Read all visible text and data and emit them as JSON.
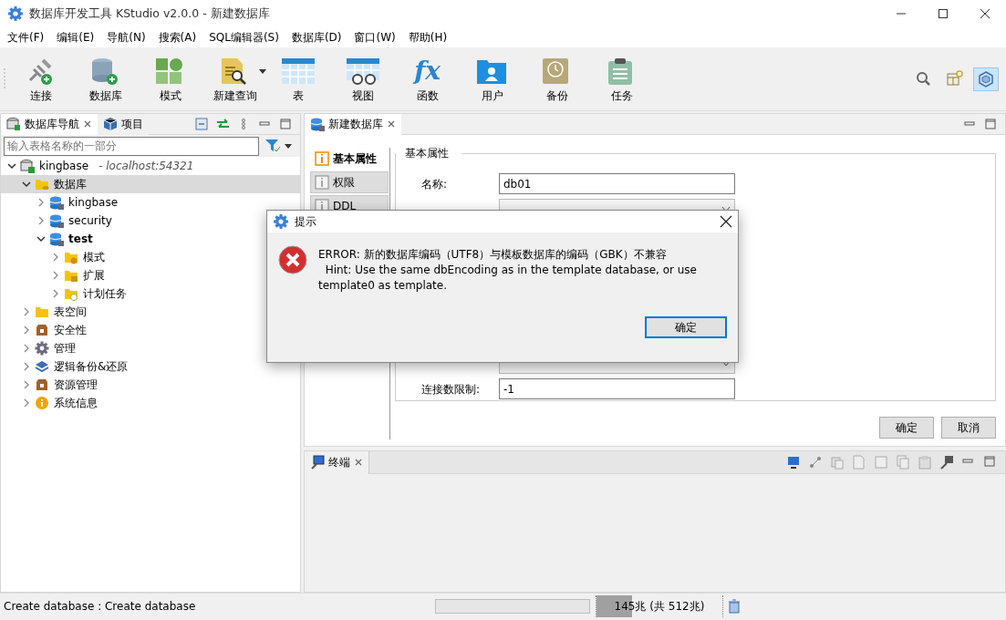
{
  "window": {
    "title": "数据库开发工具 KStudio v2.0.0 - 新建数据库"
  },
  "menu": [
    "文件(F)",
    "编辑(E)",
    "导航(N)",
    "搜索(A)",
    "SQL编辑器(S)",
    "数据库(D)",
    "窗口(W)",
    "帮助(H)"
  ],
  "toolbar": [
    {
      "label": "连接",
      "kind": "connect"
    },
    {
      "label": "数据库",
      "kind": "database"
    },
    {
      "label": "模式",
      "kind": "schema"
    },
    {
      "label": "新建查询",
      "kind": "query",
      "dropdown": true
    },
    {
      "label": "表",
      "kind": "table"
    },
    {
      "label": "视图",
      "kind": "view"
    },
    {
      "label": "函数",
      "kind": "function",
      "glyph": "fx"
    },
    {
      "label": "用户",
      "kind": "user"
    },
    {
      "label": "备份",
      "kind": "backup"
    },
    {
      "label": "任务",
      "kind": "task"
    }
  ],
  "toolbar_right": [
    {
      "kind": "search",
      "selected": false
    },
    {
      "kind": "table-add",
      "selected": false
    },
    {
      "kind": "cube",
      "selected": true
    }
  ],
  "navigator": {
    "tabs": [
      {
        "label": "数据库导航",
        "selected": true,
        "closable": true
      },
      {
        "label": "项目",
        "selected": false,
        "closable": false
      }
    ],
    "filter": {
      "placeholder": "输入表格名称的一部分"
    },
    "tree": [
      {
        "label": "kingbase",
        "host": "- localhost:54321",
        "kind": "connection",
        "expanded": true,
        "selected": false,
        "bold": false,
        "children": [
          {
            "label": "数据库",
            "kind": "folder-db",
            "expanded": true,
            "selected": true,
            "bold": false,
            "children": [
              {
                "label": "kingbase",
                "kind": "database",
                "expanded": false,
                "selected": false,
                "bold": false
              },
              {
                "label": "security",
                "kind": "database",
                "expanded": false,
                "selected": false,
                "bold": false
              },
              {
                "label": "test",
                "kind": "database",
                "expanded": true,
                "selected": false,
                "bold": true,
                "children": [
                  {
                    "label": "模式",
                    "kind": "folder-schema",
                    "expanded": false,
                    "selected": false,
                    "bold": false
                  },
                  {
                    "label": "扩展",
                    "kind": "folder-ext",
                    "expanded": false,
                    "selected": false,
                    "bold": false
                  },
                  {
                    "label": "计划任务",
                    "kind": "folder-task",
                    "expanded": false,
                    "selected": false,
                    "bold": false
                  }
                ]
              }
            ]
          },
          {
            "label": "表空间",
            "kind": "folder",
            "expanded": false,
            "selected": false,
            "bold": false
          },
          {
            "label": "安全性",
            "kind": "lock",
            "expanded": false,
            "selected": false,
            "bold": false
          },
          {
            "label": "管理",
            "kind": "gear",
            "expanded": false,
            "selected": false,
            "bold": false
          },
          {
            "label": "逻辑备份&还原",
            "kind": "layers",
            "expanded": false,
            "selected": false,
            "bold": false
          },
          {
            "label": "资源管理",
            "kind": "lock",
            "expanded": false,
            "selected": false,
            "bold": false
          },
          {
            "label": "系统信息",
            "kind": "info",
            "expanded": false,
            "selected": false,
            "bold": false
          }
        ]
      }
    ]
  },
  "editor": {
    "tab": {
      "label": "新建数据库",
      "selected": true
    },
    "side_tabs": [
      {
        "label": "基本属性",
        "selected": true
      },
      {
        "label": "权限",
        "selected": false
      },
      {
        "label": "DDL",
        "selected": false
      }
    ],
    "group_title": "基本属性",
    "fields": [
      {
        "label": "名称:",
        "value": "db01",
        "kind": "text"
      },
      {
        "kind": "select"
      },
      {
        "kind": "select"
      },
      {
        "label": "连接数限制:",
        "value": "-1",
        "kind": "text"
      }
    ],
    "buttons": [
      "确定",
      "取消"
    ]
  },
  "terminal": {
    "tab": {
      "label": "终端",
      "selected": true
    }
  },
  "dialog": {
    "title": "提示",
    "message": [
      "ERROR: 新的数据库编码（UTF8）与模板数据库的编码（GBK）不兼容",
      "  Hint: Use the same dbEncoding as in the template database, or use",
      "template0 as template."
    ],
    "button": "确定"
  },
  "status_bar": {
    "text": "Create database : Create database",
    "progress": {
      "level": 0
    },
    "memory": {
      "text": "145兆 (共 512兆)",
      "level": 0.283
    }
  }
}
